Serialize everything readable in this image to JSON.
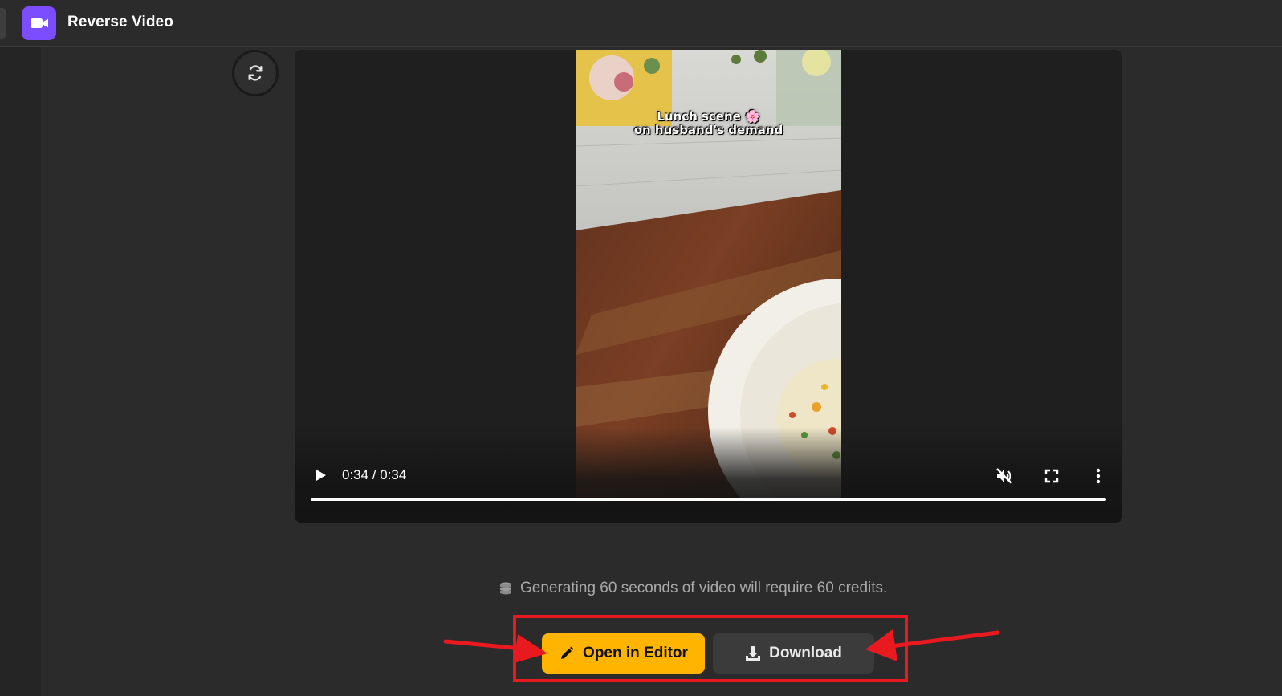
{
  "app": {
    "title": "Reverse Video",
    "icon": "video-camera-icon",
    "accent_color": "#7c4dff"
  },
  "toolbar": {
    "refresh_icon": "refresh-icon"
  },
  "video": {
    "overlay_line1": "Lunch scene 🌸",
    "overlay_line2": "on husband's demand",
    "time_display": "0:34 / 0:34",
    "progress": 1.0,
    "muted": true,
    "controls": {
      "play_icon": "play-icon",
      "mute_icon": "muted-speaker-icon",
      "fullscreen_icon": "fullscreen-icon",
      "more_icon": "more-vertical-icon"
    }
  },
  "credits": {
    "icon": "coins-icon",
    "text": "Generating 60 seconds of video will require 60 credits."
  },
  "actions": {
    "open_editor_label": "Open in Editor",
    "open_editor_icon": "pencil-icon",
    "download_label": "Download",
    "download_icon": "download-icon",
    "highlight_color": "#e8191f",
    "primary_color": "#ffb400"
  }
}
